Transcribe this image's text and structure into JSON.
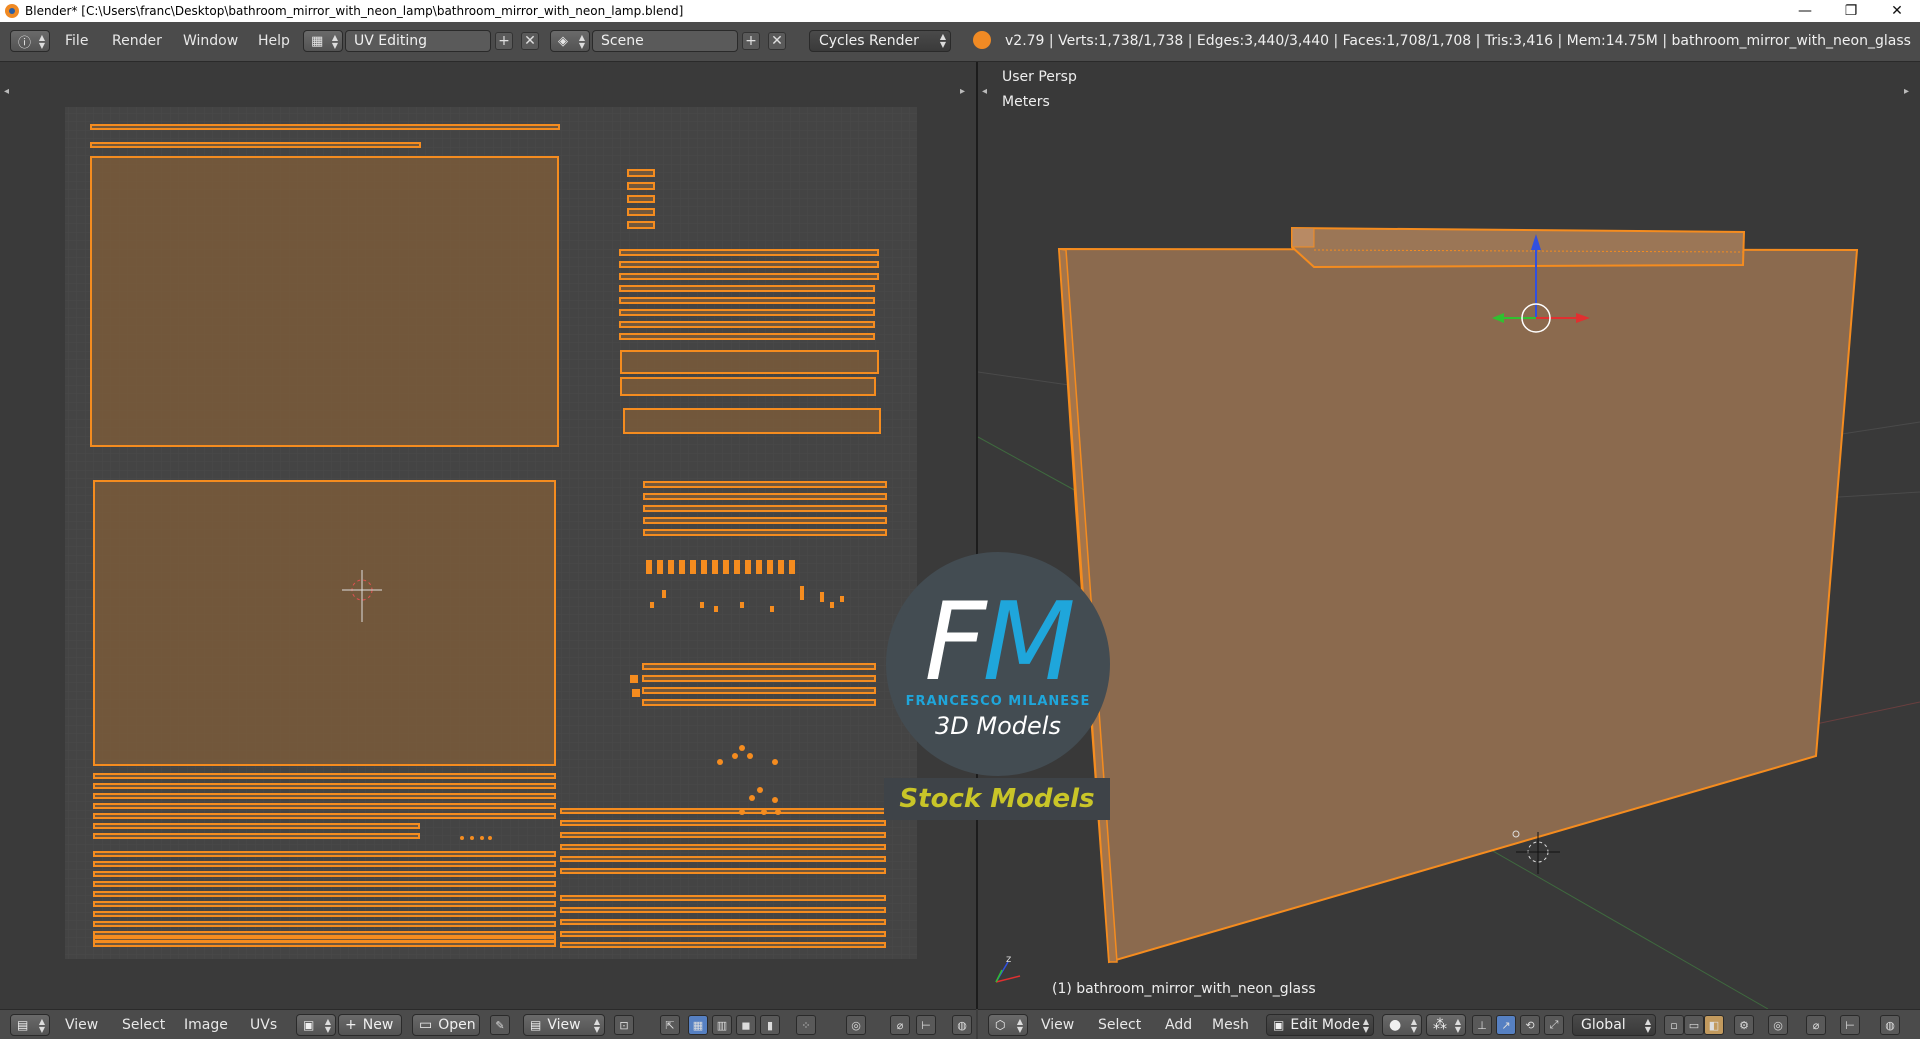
{
  "window": {
    "title": "Blender* [C:\\Users\\franc\\Desktop\\bathroom_mirror_with_neon_lamp\\bathroom_mirror_with_neon_lamp.blend]",
    "minimize": "—",
    "maximize": "❐",
    "close": "✕"
  },
  "info_header": {
    "menus": [
      "File",
      "Render",
      "Window",
      "Help"
    ],
    "screen_layout": "UV Editing",
    "scene": "Scene",
    "render_engine": "Cycles Render",
    "stats": "v2.79 | Verts:1,738/1,738 | Edges:3,440/3,440 | Faces:1,708/1,708 | Tris:3,416 | Mem:14.75M | bathroom_mirror_with_neon_glass"
  },
  "uv_editor": {
    "menus": [
      "View",
      "Select",
      "Image",
      "UVs"
    ],
    "new_label": "New",
    "open_label": "Open",
    "view_label": "View"
  },
  "viewport": {
    "view_name": "User Persp",
    "units": "Meters",
    "object_label": "(1) bathroom_mirror_with_neon_glass",
    "menus": [
      "View",
      "Select",
      "Add",
      "Mesh"
    ],
    "mode": "Edit Mode",
    "orientation": "Global"
  },
  "watermark": {
    "letters_f": "F",
    "letters_m": "M",
    "name": "FRANCESCO MILANESE",
    "subtitle": "3D Models",
    "banner": "Stock Models"
  },
  "colors": {
    "accent": "#f58c1f",
    "uv_fill": "#7a5a3a",
    "mesh_fill": "#8b6a4e",
    "logo_blue": "#1fa6db",
    "banner_yellow": "#c9c528"
  }
}
